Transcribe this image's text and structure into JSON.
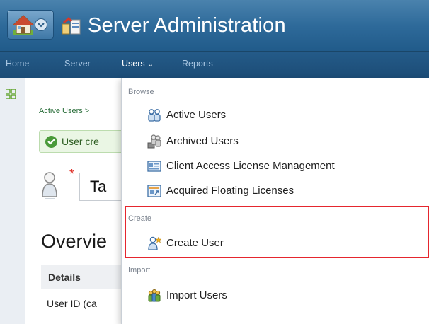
{
  "header": {
    "app_title": "Server Administration",
    "home_icon": "home-icon",
    "app_icon": "server-admin-icon"
  },
  "nav": {
    "items": [
      {
        "label": "Home",
        "active": false
      },
      {
        "label": "Server",
        "active": false
      },
      {
        "label": "Users",
        "active": true
      },
      {
        "label": "Reports",
        "active": false
      }
    ],
    "dropdown_caret_icon": "chevron-down-icon"
  },
  "page": {
    "breadcrumb": "Active Users >",
    "success_message": "User cre",
    "name_value": "Ta",
    "overview_title": "Overvie",
    "details_header": "Details",
    "user_id_label": "User ID (ca"
  },
  "dropdown": {
    "browse": {
      "heading": "Browse",
      "items": [
        {
          "label": "Active Users",
          "icon": "active-users-icon"
        },
        {
          "label": "Archived Users",
          "icon": "archived-users-icon"
        },
        {
          "label": "Client Access License Management",
          "icon": "license-management-icon"
        },
        {
          "label": "Acquired Floating Licenses",
          "icon": "floating-license-icon"
        }
      ]
    },
    "create": {
      "heading": "Create",
      "items": [
        {
          "label": "Create User",
          "icon": "create-user-icon"
        }
      ]
    },
    "import": {
      "heading": "Import",
      "items": [
        {
          "label": "Import Users",
          "icon": "import-users-icon"
        }
      ]
    }
  },
  "colors": {
    "header_blue": "#2e6a9a",
    "nav_blue": "#1c4c76",
    "highlight_red": "#e5262e",
    "success_green": "#4a9a3a"
  }
}
